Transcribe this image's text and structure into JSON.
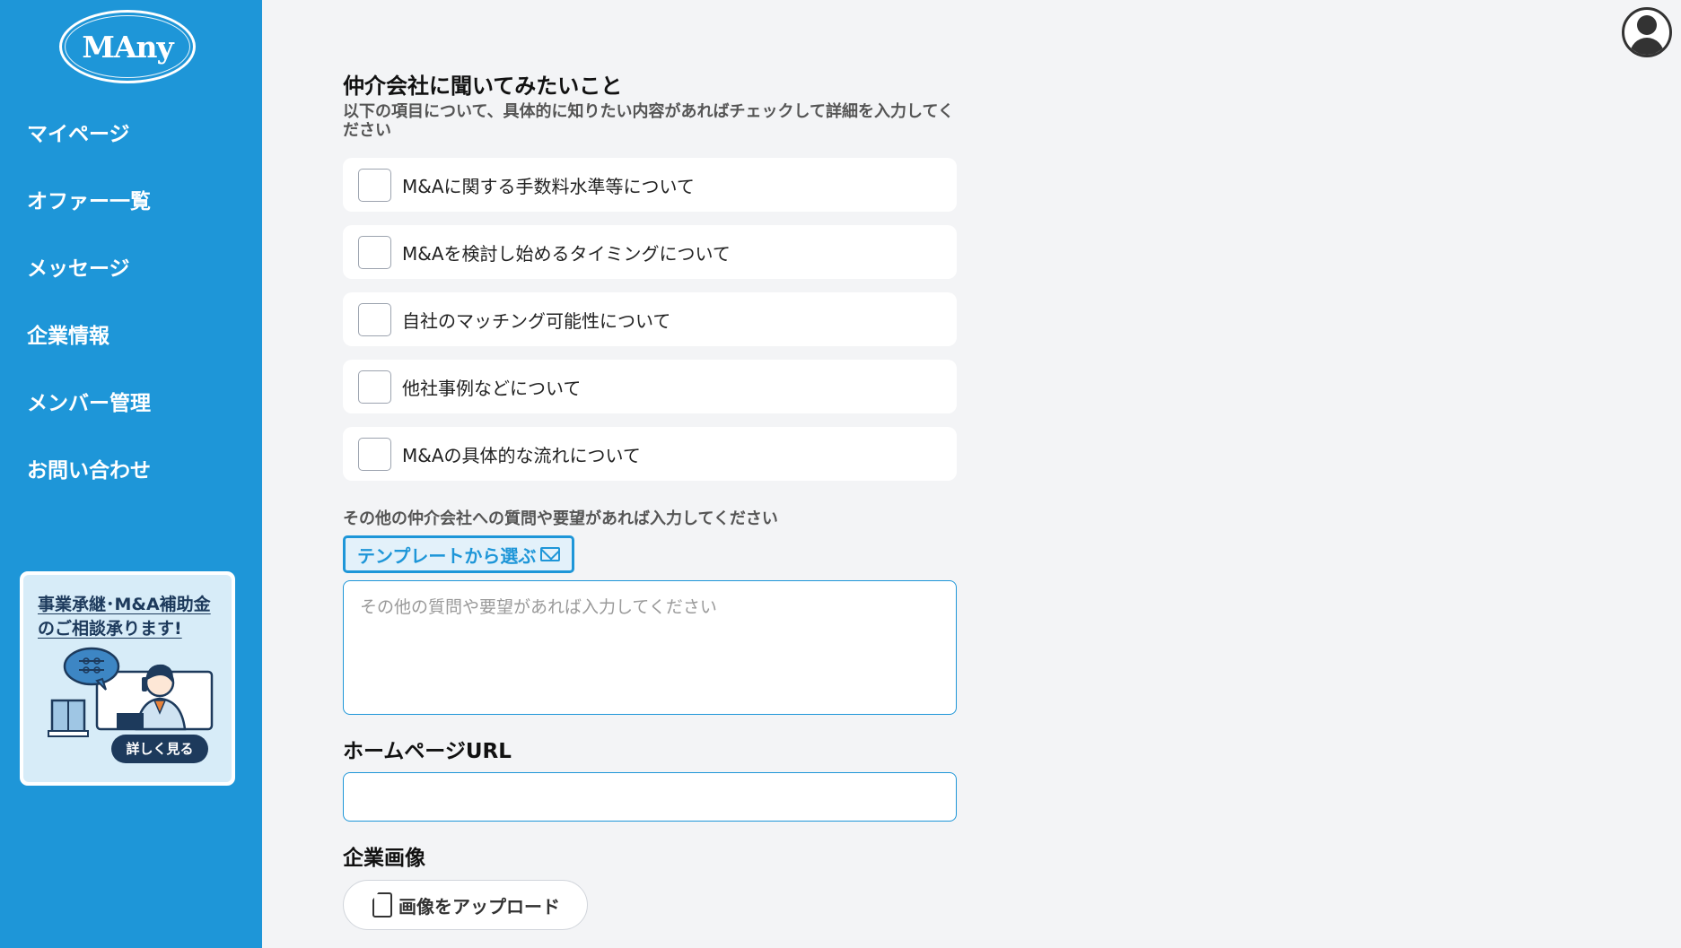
{
  "sidebar": {
    "logo": "MAny",
    "items": [
      {
        "label": "マイページ"
      },
      {
        "label": "オファー一覧"
      },
      {
        "label": "メッセージ"
      },
      {
        "label": "企業情報"
      },
      {
        "label": "メンバー管理"
      },
      {
        "label": "お問い合わせ"
      }
    ],
    "banner": {
      "title_line1": "事業承継･M&A補助金",
      "title_line2": "のご相談承ります!",
      "button": "詳しく見る"
    }
  },
  "form": {
    "section_title": "仲介会社に聞いてみたいこと",
    "section_desc": "以下の項目について、具体的に知りたい内容があればチェックして詳細を入力してください",
    "checkboxes": [
      {
        "label": "M&Aに関する手数料水準等について",
        "checked": false
      },
      {
        "label": "M&Aを検討し始めるタイミングについて",
        "checked": false
      },
      {
        "label": "自社のマッチング可能性について",
        "checked": false
      },
      {
        "label": "他社事例などについて",
        "checked": false
      },
      {
        "label": "M&Aの具体的な流れについて",
        "checked": false
      }
    ],
    "other_label": "その他の仲介会社への質問や要望があれば入力してください",
    "template_button": "テンプレートから選ぶ",
    "other_placeholder": "その他の質問や要望があれば入力してください",
    "other_value": "",
    "homepage_title": "ホームページURL",
    "homepage_value": "",
    "image_title": "企業画像",
    "upload_button": "画像をアップロード"
  },
  "colors": {
    "sidebar": "#1e96d8",
    "accent": "#1e96d8",
    "background": "#f3f4f6"
  }
}
